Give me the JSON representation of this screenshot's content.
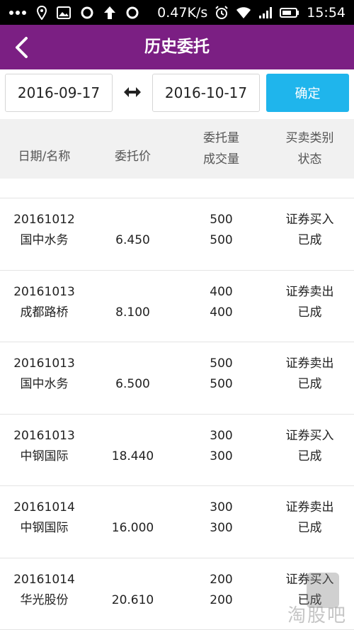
{
  "status_bar": {
    "speed": "0.47K/s",
    "time": "15:54",
    "icons": [
      "more-dots-icon",
      "location-pin-icon",
      "image-icon",
      "circle-icon",
      "upload-arrow-icon",
      "circle-icon",
      "alarm-icon",
      "wifi-icon",
      "signal-icon",
      "battery-icon"
    ]
  },
  "navbar": {
    "title": "历史委托",
    "back_icon": "chevron-left-icon",
    "background": "#7b1f83"
  },
  "date_filter": {
    "start_date": "2016-09-17",
    "end_date": "2016-10-17",
    "swap_icon": "double-arrow-icon",
    "confirm_label": "确定",
    "confirm_color": "#1fb5ec"
  },
  "table_header": {
    "col1": "日期/名称",
    "col2": "委托价",
    "col3_line1": "委托量",
    "col3_line2": "成交量",
    "col4_line1": "买卖类别",
    "col4_line2": "状态"
  },
  "rows": [
    {
      "date": "20161012",
      "name": "国中水务",
      "price": "6.450",
      "order_qty": "500",
      "deal_qty": "500",
      "type": "证券买入",
      "state": "已成"
    },
    {
      "date": "20161013",
      "name": "成都路桥",
      "price": "8.100",
      "order_qty": "400",
      "deal_qty": "400",
      "type": "证券卖出",
      "state": "已成"
    },
    {
      "date": "20161013",
      "name": "国中水务",
      "price": "6.500",
      "order_qty": "500",
      "deal_qty": "500",
      "type": "证券卖出",
      "state": "已成"
    },
    {
      "date": "20161013",
      "name": "中钢国际",
      "price": "18.440",
      "order_qty": "300",
      "deal_qty": "300",
      "type": "证券买入",
      "state": "已成"
    },
    {
      "date": "20161014",
      "name": "中钢国际",
      "price": "16.000",
      "order_qty": "300",
      "deal_qty": "300",
      "type": "证券卖出",
      "state": "已成"
    },
    {
      "date": "20161014",
      "name": "华光股份",
      "price": "20.610",
      "order_qty": "200",
      "deal_qty": "200",
      "type": "证券买入",
      "state": "已成"
    }
  ],
  "watermark": "淘股吧"
}
